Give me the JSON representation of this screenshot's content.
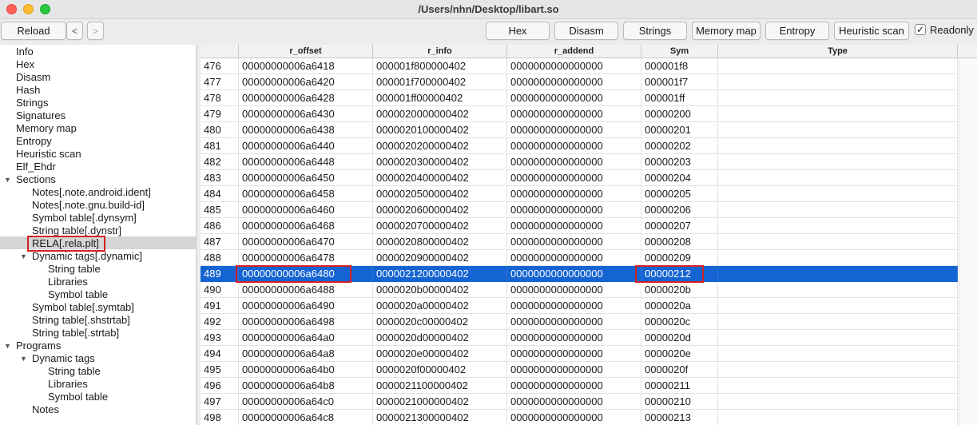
{
  "window": {
    "title": "/Users/nhn/Desktop/libart.so"
  },
  "toolbar": {
    "reload_label": "Reload",
    "back_label": "<",
    "forward_label": ">",
    "hex_label": "Hex",
    "disasm_label": "Disasm",
    "strings_label": "Strings",
    "memory_map_label": "Memory map",
    "entropy_label": "Entropy",
    "heuristic_scan_label": "Heuristic scan",
    "readonly_label": "Readonly",
    "readonly_checked": "✓"
  },
  "tree": {
    "items": [
      {
        "label": "Info"
      },
      {
        "label": "Hex"
      },
      {
        "label": "Disasm"
      },
      {
        "label": "Hash"
      },
      {
        "label": "Strings"
      },
      {
        "label": "Signatures"
      },
      {
        "label": "Memory map"
      },
      {
        "label": "Entropy"
      },
      {
        "label": "Heuristic scan"
      },
      {
        "label": "Elf_Ehdr"
      },
      {
        "label": "Sections",
        "arrow": "▼"
      },
      {
        "label": "Notes[.note.android.ident]"
      },
      {
        "label": "Notes[.note.gnu.build-id]"
      },
      {
        "label": "Symbol table[.dynsym]"
      },
      {
        "label": "String table[.dynstr]"
      },
      {
        "label": "RELA[.rela.plt]"
      },
      {
        "label": "Dynamic tags[.dynamic]",
        "arrow": "▼"
      },
      {
        "label": "String table"
      },
      {
        "label": "Libraries"
      },
      {
        "label": "Symbol table"
      },
      {
        "label": "Symbol table[.symtab]"
      },
      {
        "label": "String table[.shstrtab]"
      },
      {
        "label": "String table[.strtab]"
      },
      {
        "label": "Programs",
        "arrow": "▼"
      },
      {
        "label": "Dynamic tags",
        "arrow": "▼"
      },
      {
        "label": "String table"
      },
      {
        "label": "Libraries"
      },
      {
        "label": "Symbol table"
      },
      {
        "label": "Notes"
      }
    ]
  },
  "table": {
    "columns": [
      "r_offset",
      "r_info",
      "r_addend",
      "Sym",
      "Type"
    ],
    "selected_row": "489",
    "rows": [
      [
        "476",
        "00000000006a6418",
        "000001f800000402",
        "0000000000000000",
        "000001f8"
      ],
      [
        "477",
        "00000000006a6420",
        "000001f700000402",
        "0000000000000000",
        "000001f7"
      ],
      [
        "478",
        "00000000006a6428",
        "000001ff00000402",
        "0000000000000000",
        "000001ff"
      ],
      [
        "479",
        "00000000006a6430",
        "0000020000000402",
        "0000000000000000",
        "00000200"
      ],
      [
        "480",
        "00000000006a6438",
        "0000020100000402",
        "0000000000000000",
        "00000201"
      ],
      [
        "481",
        "00000000006a6440",
        "0000020200000402",
        "0000000000000000",
        "00000202"
      ],
      [
        "482",
        "00000000006a6448",
        "0000020300000402",
        "0000000000000000",
        "00000203"
      ],
      [
        "483",
        "00000000006a6450",
        "0000020400000402",
        "0000000000000000",
        "00000204"
      ],
      [
        "484",
        "00000000006a6458",
        "0000020500000402",
        "0000000000000000",
        "00000205"
      ],
      [
        "485",
        "00000000006a6460",
        "0000020600000402",
        "0000000000000000",
        "00000206"
      ],
      [
        "486",
        "00000000006a6468",
        "0000020700000402",
        "0000000000000000",
        "00000207"
      ],
      [
        "487",
        "00000000006a6470",
        "0000020800000402",
        "0000000000000000",
        "00000208"
      ],
      [
        "488",
        "00000000006a6478",
        "0000020900000402",
        "0000000000000000",
        "00000209"
      ],
      [
        "489",
        "00000000006a6480",
        "0000021200000402",
        "0000000000000000",
        "00000212"
      ],
      [
        "490",
        "00000000006a6488",
        "0000020b00000402",
        "0000000000000000",
        "0000020b"
      ],
      [
        "491",
        "00000000006a6490",
        "0000020a00000402",
        "0000000000000000",
        "0000020a"
      ],
      [
        "492",
        "00000000006a6498",
        "0000020c00000402",
        "0000000000000000",
        "0000020c"
      ],
      [
        "493",
        "00000000006a64a0",
        "0000020d00000402",
        "0000000000000000",
        "0000020d"
      ],
      [
        "494",
        "00000000006a64a8",
        "0000020e00000402",
        "0000000000000000",
        "0000020e"
      ],
      [
        "495",
        "00000000006a64b0",
        "0000020f00000402",
        "0000000000000000",
        "0000020f"
      ],
      [
        "496",
        "00000000006a64b8",
        "0000021100000402",
        "0000000000000000",
        "00000211"
      ],
      [
        "497",
        "00000000006a64c0",
        "0000021000000402",
        "0000000000000000",
        "00000210"
      ],
      [
        "498",
        "00000000006a64c8",
        "0000021300000402",
        "0000000000000000",
        "00000213"
      ]
    ]
  },
  "colors": {
    "selection": "#1464d3",
    "highlight_box": "#d42020"
  }
}
